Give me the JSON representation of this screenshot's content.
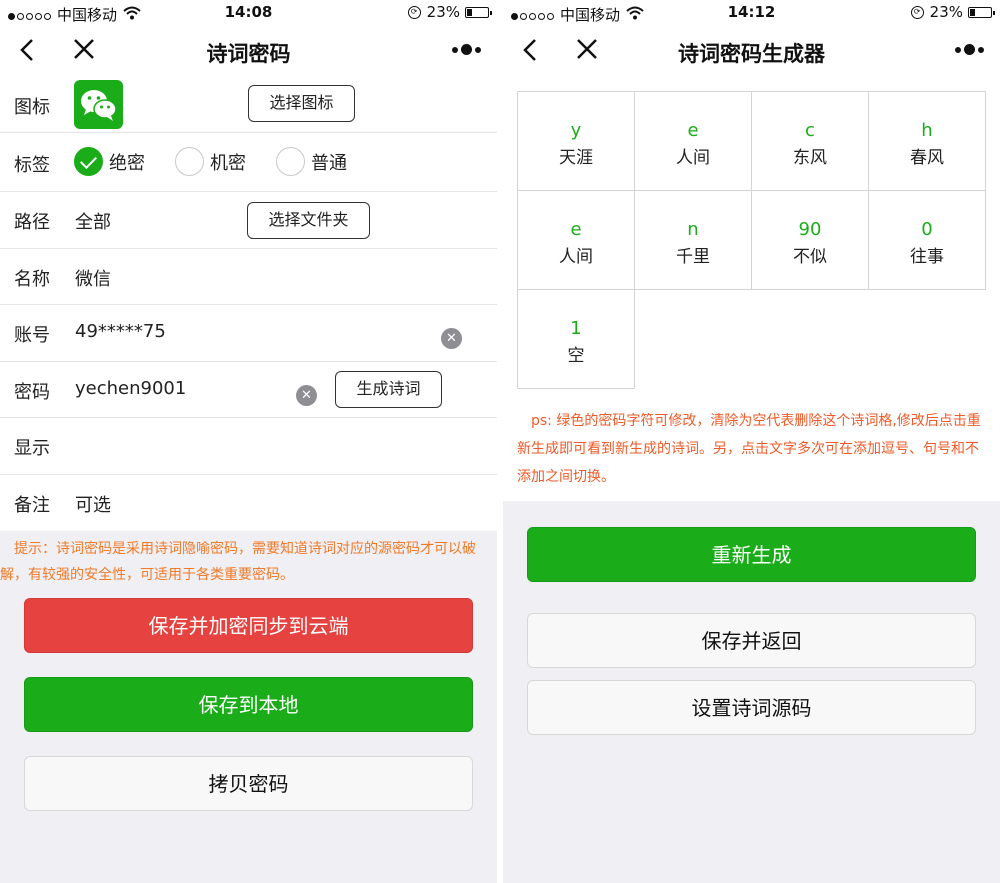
{
  "left": {
    "status": {
      "carrier": "中国移动",
      "time": "14:08",
      "battery": "23%"
    },
    "nav": {
      "title": "诗词密码"
    },
    "fields": {
      "icon_label": "图标",
      "icon_button": "选择图标",
      "tag_label": "标签",
      "tag_options": [
        "绝密",
        "机密",
        "普通"
      ],
      "tag_selected": "绝密",
      "path_label": "路径",
      "path_value": "全部",
      "path_button": "选择文件夹",
      "name_label": "名称",
      "name_value": "微信",
      "account_label": "账号",
      "account_value": "49*****75",
      "password_label": "密码",
      "password_value": "yechen9001",
      "generate_button": "生成诗词",
      "display_label": "显示",
      "note_label": "备注",
      "note_placeholder": "可选"
    },
    "tip": "提示：诗词密码是采用诗词隐喻密码，需要知道诗词对应的源密码才可以破解，有较强的安全性，可适用于各类重要密码。",
    "buttons": {
      "save_cloud": "保存并加密同步到云端",
      "save_local": "保存到本地",
      "copy": "拷贝密码"
    }
  },
  "right": {
    "status": {
      "carrier": "中国移动",
      "time": "14:12",
      "battery": "23%"
    },
    "nav": {
      "title": "诗词密码生成器"
    },
    "cells": [
      {
        "code": "y",
        "word": "天涯"
      },
      {
        "code": "e",
        "word": "人间"
      },
      {
        "code": "c",
        "word": "东风"
      },
      {
        "code": "h",
        "word": "春风"
      },
      {
        "code": "e",
        "word": "人间"
      },
      {
        "code": "n",
        "word": "千里"
      },
      {
        "code": "90",
        "word": "不似"
      },
      {
        "code": "0",
        "word": "往事"
      },
      {
        "code": "1",
        "word": "空"
      }
    ],
    "note": "ps: 绿色的密码字符可修改，清除为空代表删除这个诗词格,修改后点击重新生成即可看到新生成的诗词。另，点击文字多次可在添加逗号、句号和不添加之间切换。",
    "buttons": {
      "regenerate": "重新生成",
      "save_return": "保存并返回",
      "set_source": "设置诗词源码"
    }
  },
  "colors": {
    "green": "#1aad19",
    "red": "#e64340",
    "tip_orange": "#f07a28",
    "code_green": "#1aad19"
  },
  "icons": [
    "back-arrow-icon",
    "close-icon",
    "more-icon",
    "wifi-icon",
    "rotation-lock-icon",
    "battery-icon",
    "wechat-app-icon",
    "checkmark-icon",
    "clear-input-icon"
  ]
}
